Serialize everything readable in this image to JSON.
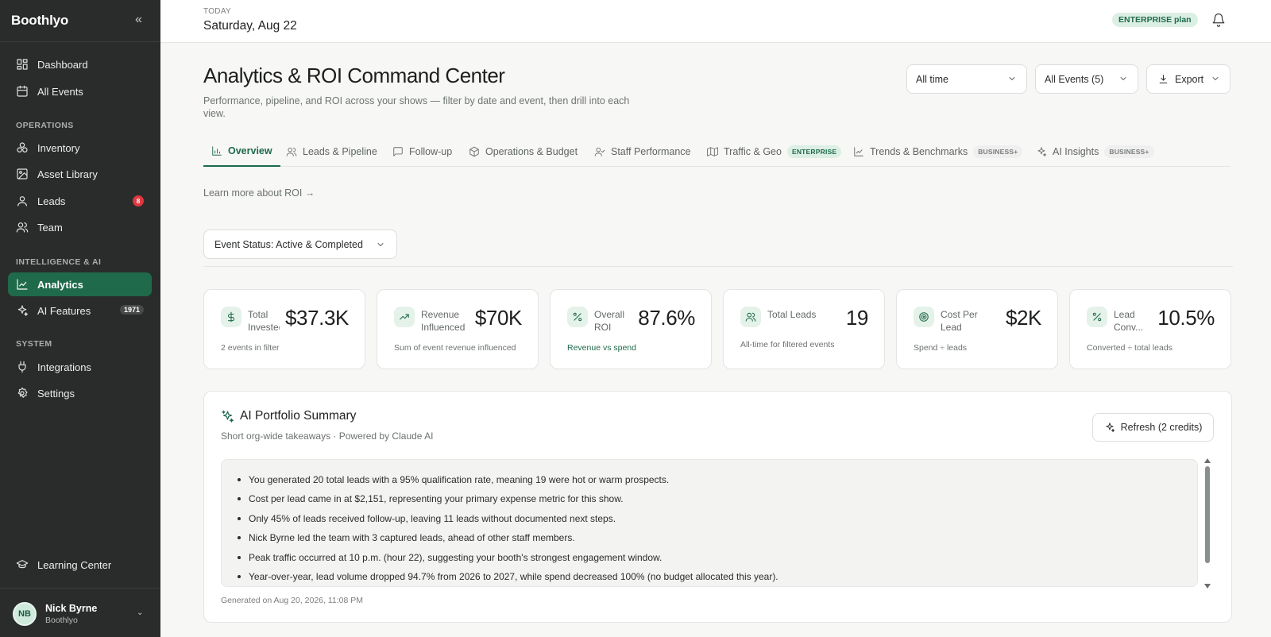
{
  "sidebar": {
    "brand": "Boothlyo",
    "collapse_icon": "chevrons-left-icon",
    "items": [
      {
        "label": "Dashboard",
        "icon": "layout-grid-icon"
      },
      {
        "label": "All Events",
        "icon": "calendar-icon"
      },
      {
        "label": "Inventory",
        "icon": "boxes-icon"
      },
      {
        "label": "Asset Library",
        "icon": "image-icon"
      },
      {
        "label": "Leads",
        "icon": "user-icon",
        "badge": "8"
      },
      {
        "label": "Team",
        "icon": "users-icon"
      },
      {
        "label": "Analytics",
        "icon": "line-chart-icon",
        "active": true
      },
      {
        "label": "AI Features",
        "icon": "sparkles-icon",
        "badge": "1971"
      },
      {
        "label": "Integrations",
        "icon": "plug-icon"
      },
      {
        "label": "Settings",
        "icon": "gear-icon"
      },
      {
        "label": "Learning Center",
        "icon": "graduation-cap-icon"
      }
    ],
    "sections": {
      "operations": "OPERATIONS",
      "intelligence": "INTELLIGENCE & AI",
      "system": "SYSTEM"
    },
    "user": {
      "initials": "NB",
      "name": "Nick Byrne",
      "org": "Boothlyo"
    }
  },
  "header": {
    "today_label": "TODAY",
    "date": "Saturday, Aug 22",
    "plan_badge": "ENTERPRISE plan",
    "bell_icon": "bell-icon"
  },
  "main": {
    "title": "Analytics & ROI Command Center",
    "subtitle": "Performance, pipeline, and ROI across your shows — filter by date and event, then drill into each view.",
    "filters": {
      "date_range": "All time",
      "events": "All Events (5)",
      "export": "Export"
    },
    "tabs": [
      {
        "label": "Overview",
        "icon": "bar-chart-icon",
        "active": true
      },
      {
        "label": "Leads & Pipeline",
        "icon": "users-icon"
      },
      {
        "label": "Follow-up",
        "icon": "message-square-icon"
      },
      {
        "label": "Operations & Budget",
        "icon": "package-icon"
      },
      {
        "label": "Staff Performance",
        "icon": "user-check-icon"
      },
      {
        "label": "Traffic & Geo",
        "icon": "map-icon",
        "badge": "ENTERPRISE"
      },
      {
        "label": "Trends & Benchmarks",
        "icon": "line-chart-icon",
        "badge": "BUSINESS+"
      },
      {
        "label": "AI Insights",
        "icon": "sparkles-icon",
        "badge": "BUSINESS+"
      }
    ],
    "learn_more": "Learn more about ROI →",
    "status_filter": "Event Status: Active & Completed",
    "kpis": [
      {
        "label": "Total Invested",
        "value": "$37.3K",
        "footer": "2 events in filter",
        "icon": "dollar-icon"
      },
      {
        "label": "Revenue Influenced",
        "value": "$70K",
        "footer": "Sum of event revenue influenced",
        "icon": "trending-up-icon"
      },
      {
        "label": "Overall ROI",
        "value": "87.6%",
        "footer": "Revenue vs spend",
        "icon": "percent-icon"
      },
      {
        "label": "Total Leads",
        "value": "19",
        "footer": "All-time for filtered events",
        "icon": "users-icon"
      },
      {
        "label": "Cost Per Lead",
        "value": "$2K",
        "footer": "Spend ÷ leads",
        "icon": "target-icon"
      },
      {
        "label": "Lead Conv...",
        "value": "10.5%",
        "footer": "Converted ÷ total leads",
        "icon": "percent-icon"
      }
    ],
    "ai_summary": {
      "title": "AI Portfolio Summary",
      "subtitle": "Short org-wide takeaways · Powered by Claude AI",
      "refresh": "Refresh (2 credits)",
      "bullets": [
        "You generated 20 total leads with a 95% qualification rate, meaning 19 were hot or warm prospects.",
        "Cost per lead came in at $2,151, representing your primary expense metric for this show.",
        "Only 45% of leads received follow-up, leaving 11 leads without documented next steps.",
        "Nick Byrne led the team with 3 captured leads, ahead of other staff members.",
        "Peak traffic occurred at 10 p.m. (hour 22), suggesting your booth's strongest engagement window.",
        "Year-over-year, lead volume dropped 94.7% from 2026 to 2027, while spend decreased 100% (no budget allocated this year)."
      ],
      "generated": "Generated on Aug 20, 2026, 11:08 PM"
    }
  }
}
